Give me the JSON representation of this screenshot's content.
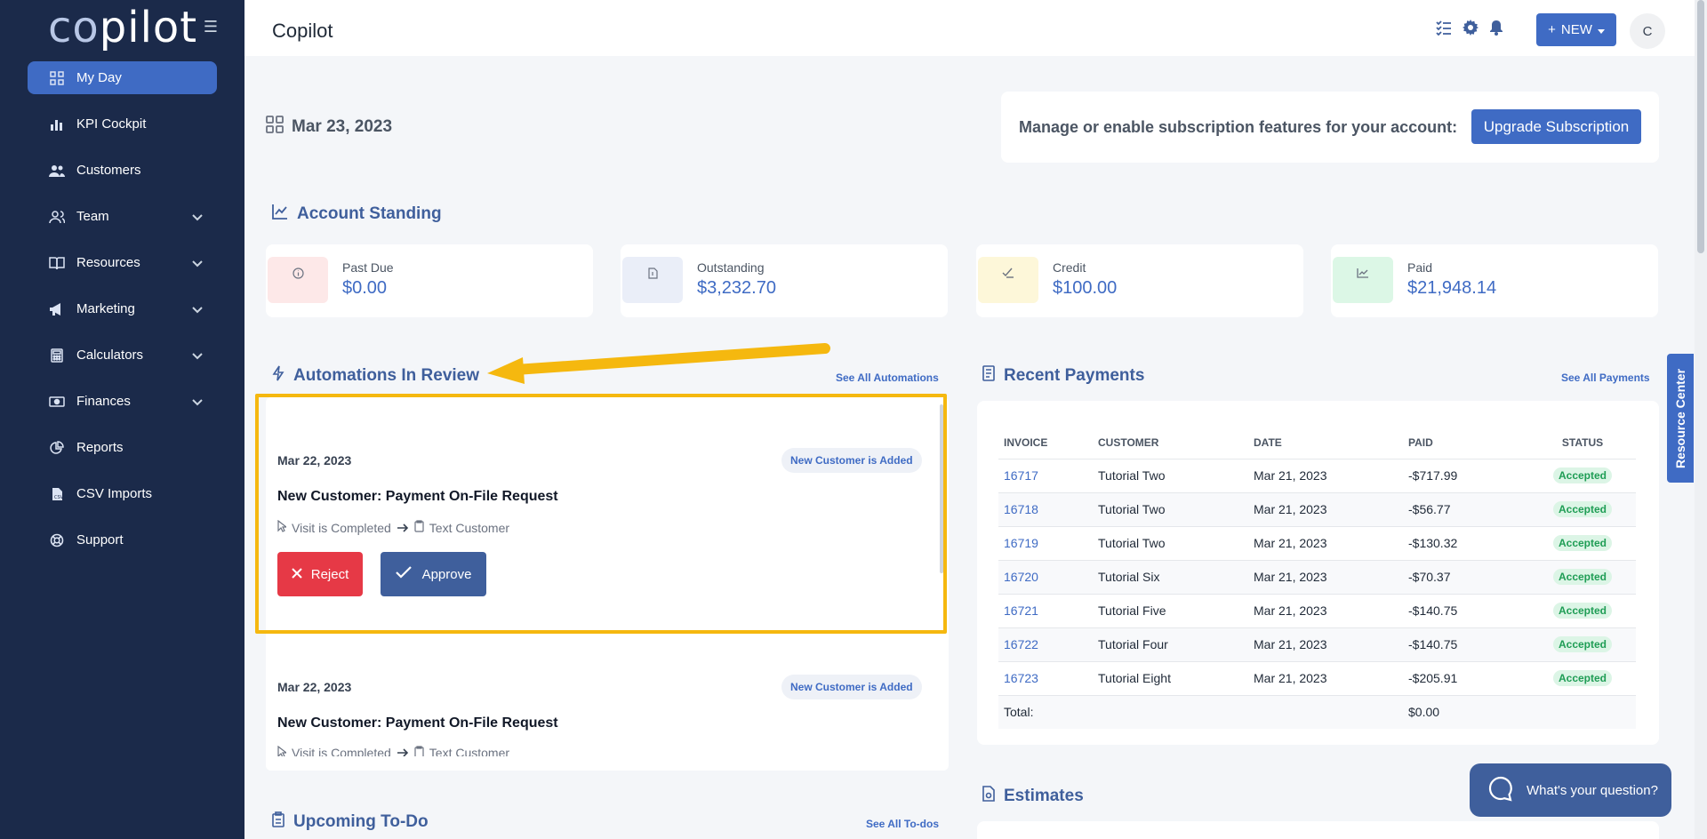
{
  "app": {
    "logo_prefix": "co",
    "logo_suffix": "pilot",
    "page_title": "Copilot"
  },
  "sidebar": {
    "items": [
      {
        "label": "My Day",
        "icon": "grid-icon",
        "active": true
      },
      {
        "label": "KPI Cockpit",
        "icon": "bar-chart-icon"
      },
      {
        "label": "Customers",
        "icon": "users-icon"
      },
      {
        "label": "Team",
        "icon": "team-icon",
        "expandable": true
      },
      {
        "label": "Resources",
        "icon": "book-icon",
        "expandable": true
      },
      {
        "label": "Marketing",
        "icon": "megaphone-icon",
        "expandable": true
      },
      {
        "label": "Calculators",
        "icon": "calculator-icon",
        "expandable": true
      },
      {
        "label": "Finances",
        "icon": "money-icon",
        "expandable": true
      },
      {
        "label": "Reports",
        "icon": "pie-chart-icon"
      },
      {
        "label": "CSV Imports",
        "icon": "file-csv-icon"
      },
      {
        "label": "Support",
        "icon": "lifebuoy-icon"
      }
    ]
  },
  "topbar": {
    "new_label": "NEW",
    "avatar_initial": "C"
  },
  "dashboard": {
    "date": "Mar 23, 2023",
    "subscription_text": "Manage or enable subscription features for your account:",
    "subscription_button": "Upgrade Subscription"
  },
  "account_standing": {
    "title": "Account Standing",
    "cards": [
      {
        "label": "Past Due",
        "value": "$0.00",
        "color": "#fde8e8"
      },
      {
        "label": "Outstanding",
        "value": "$3,232.70",
        "color": "#eaeef8"
      },
      {
        "label": "Credit",
        "value": "$100.00",
        "color": "#fdf7d9"
      },
      {
        "label": "Paid",
        "value": "$21,948.14",
        "color": "#dcf7e6"
      }
    ]
  },
  "automations": {
    "title": "Automations In Review",
    "see_all": "See All Automations",
    "items": [
      {
        "date": "Mar 22, 2023",
        "badge": "New Customer is Added",
        "title": "New Customer: Payment On-File Request",
        "trigger": "Visit is Completed",
        "action": "Text Customer",
        "reject_label": "Reject",
        "approve_label": "Approve"
      },
      {
        "date": "Mar 22, 2023",
        "badge": "New Customer is Added",
        "title": "New Customer: Payment On-File Request",
        "trigger": "Visit is Completed",
        "action": "Text Customer"
      }
    ]
  },
  "recent_payments": {
    "title": "Recent Payments",
    "see_all": "See All Payments",
    "columns": [
      "INVOICE",
      "CUSTOMER",
      "DATE",
      "PAID",
      "STATUS"
    ],
    "rows": [
      {
        "invoice": "16717",
        "customer": "Tutorial Two",
        "date": "Mar 21, 2023",
        "paid": "-$717.99",
        "status": "Accepted"
      },
      {
        "invoice": "16718",
        "customer": "Tutorial Two",
        "date": "Mar 21, 2023",
        "paid": "-$56.77",
        "status": "Accepted"
      },
      {
        "invoice": "16719",
        "customer": "Tutorial Two",
        "date": "Mar 21, 2023",
        "paid": "-$130.32",
        "status": "Accepted"
      },
      {
        "invoice": "16720",
        "customer": "Tutorial Six",
        "date": "Mar 21, 2023",
        "paid": "-$70.37",
        "status": "Accepted"
      },
      {
        "invoice": "16721",
        "customer": "Tutorial Five",
        "date": "Mar 21, 2023",
        "paid": "-$140.75",
        "status": "Accepted"
      },
      {
        "invoice": "16722",
        "customer": "Tutorial Four",
        "date": "Mar 21, 2023",
        "paid": "-$140.75",
        "status": "Accepted"
      },
      {
        "invoice": "16723",
        "customer": "Tutorial Eight",
        "date": "Mar 21, 2023",
        "paid": "-$205.91",
        "status": "Accepted"
      }
    ],
    "total_label": "Total:",
    "total_value": "$0.00"
  },
  "upcoming_todo": {
    "title": "Upcoming To-Do",
    "see_all": "See All To-dos"
  },
  "estimates": {
    "title": "Estimates"
  },
  "resource_center": "Resource Center",
  "chat": "What's your question?",
  "colors": {
    "sidebar_bg": "#1b2a4a",
    "accent": "#3f6bc4",
    "highlight": "#f5b80f",
    "reject": "#e63946"
  }
}
